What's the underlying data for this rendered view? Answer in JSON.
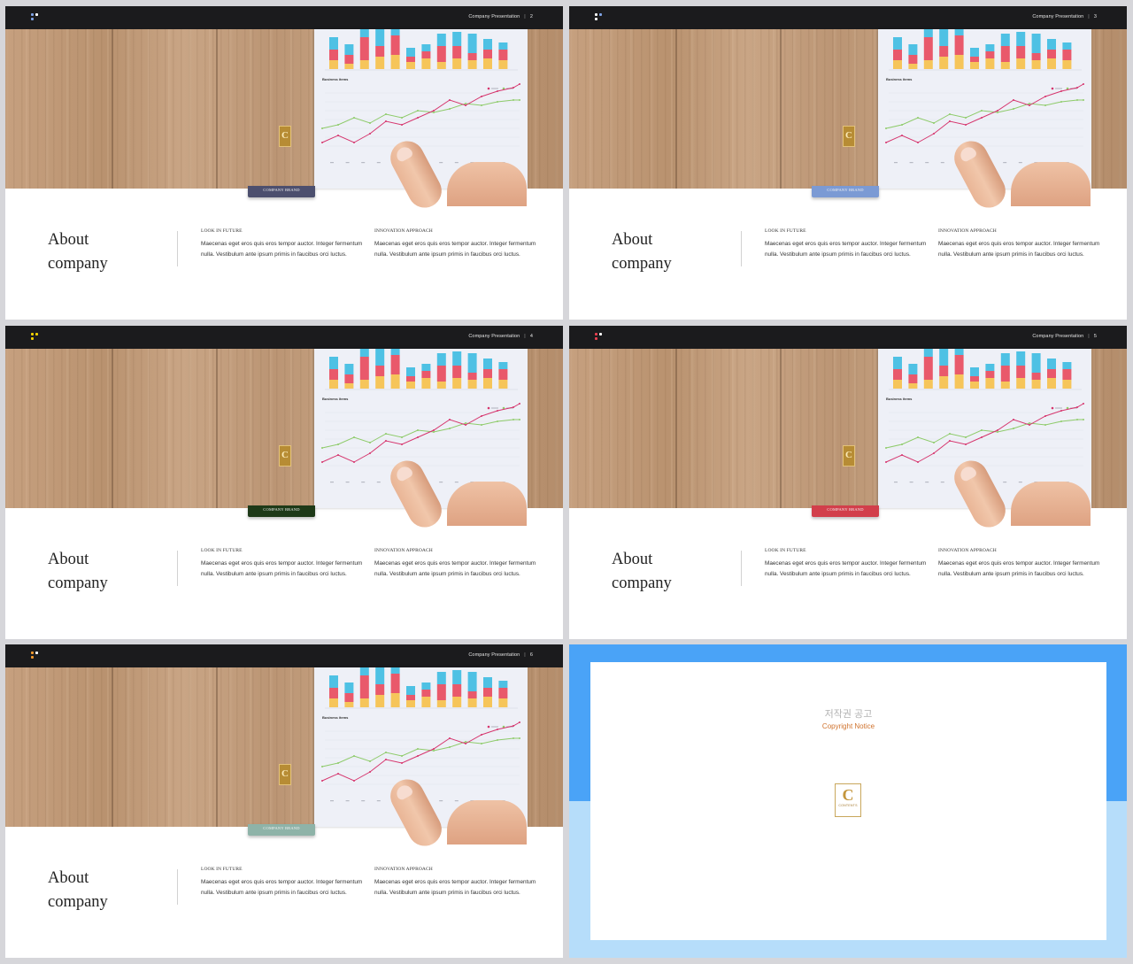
{
  "common": {
    "presentation_label": "Company Presentation",
    "separator": "|",
    "brand_tab_label": "COMPANY BRAND",
    "business_items_label": "Business items",
    "badge_letter": "C",
    "about_line1": "About",
    "about_line2": "company",
    "col1_heading": "LOOK IN FUTURE",
    "col1_body": "Maecenas eget eros quis eros tempor auctor. Integer fermentum nulla. Vestibulum ante ipsum primis in faucibus orci luctus.",
    "col2_heading": "INNOVATION APPROACH",
    "col2_body": "Maecenas eget eros quis eros tempor auctor. Integer fermentum nulla. Vestibulum ante ipsum primis in faucibus orci luctus."
  },
  "slides": [
    {
      "page": "2",
      "accent": "#4c4f6e",
      "dots": [
        "#7fa3e6",
        "#ffffff",
        "#7fa3e6"
      ]
    },
    {
      "page": "3",
      "accent": "#7b9ad4",
      "dots": [
        "#ffffff",
        "#7fa3e6",
        "#ffffff"
      ]
    },
    {
      "page": "4",
      "accent": "#1e3a18",
      "dots": [
        "#f2d100",
        "#f2d100",
        "#f2d100"
      ]
    },
    {
      "page": "5",
      "accent": "#d23f4b",
      "dots": [
        "#e84050",
        "#ffffff",
        "#e84050"
      ]
    },
    {
      "page": "6",
      "accent": "#8eb3a8",
      "dots": [
        "#f29a2e",
        "#ffffff",
        "#f29a2e"
      ]
    }
  ],
  "copyright": {
    "title_ko": "저작권 공고",
    "title_en": "Copyright Notice",
    "logo_letter": "C",
    "logo_caption": "CONTENTS",
    "paragraphs": [
      "",
      "",
      "",
      "",
      ""
    ]
  },
  "colors": {
    "top_bar": "#1b1b1d",
    "copyright_top": "#4aa3f7",
    "copyright_bottom": "#b6ddfa",
    "bar_red": "#e9596b",
    "bar_blue": "#4ec1e4",
    "bar_yellow": "#f6c55a",
    "line_red": "#d6366e",
    "line_green": "#8ecb6a"
  }
}
